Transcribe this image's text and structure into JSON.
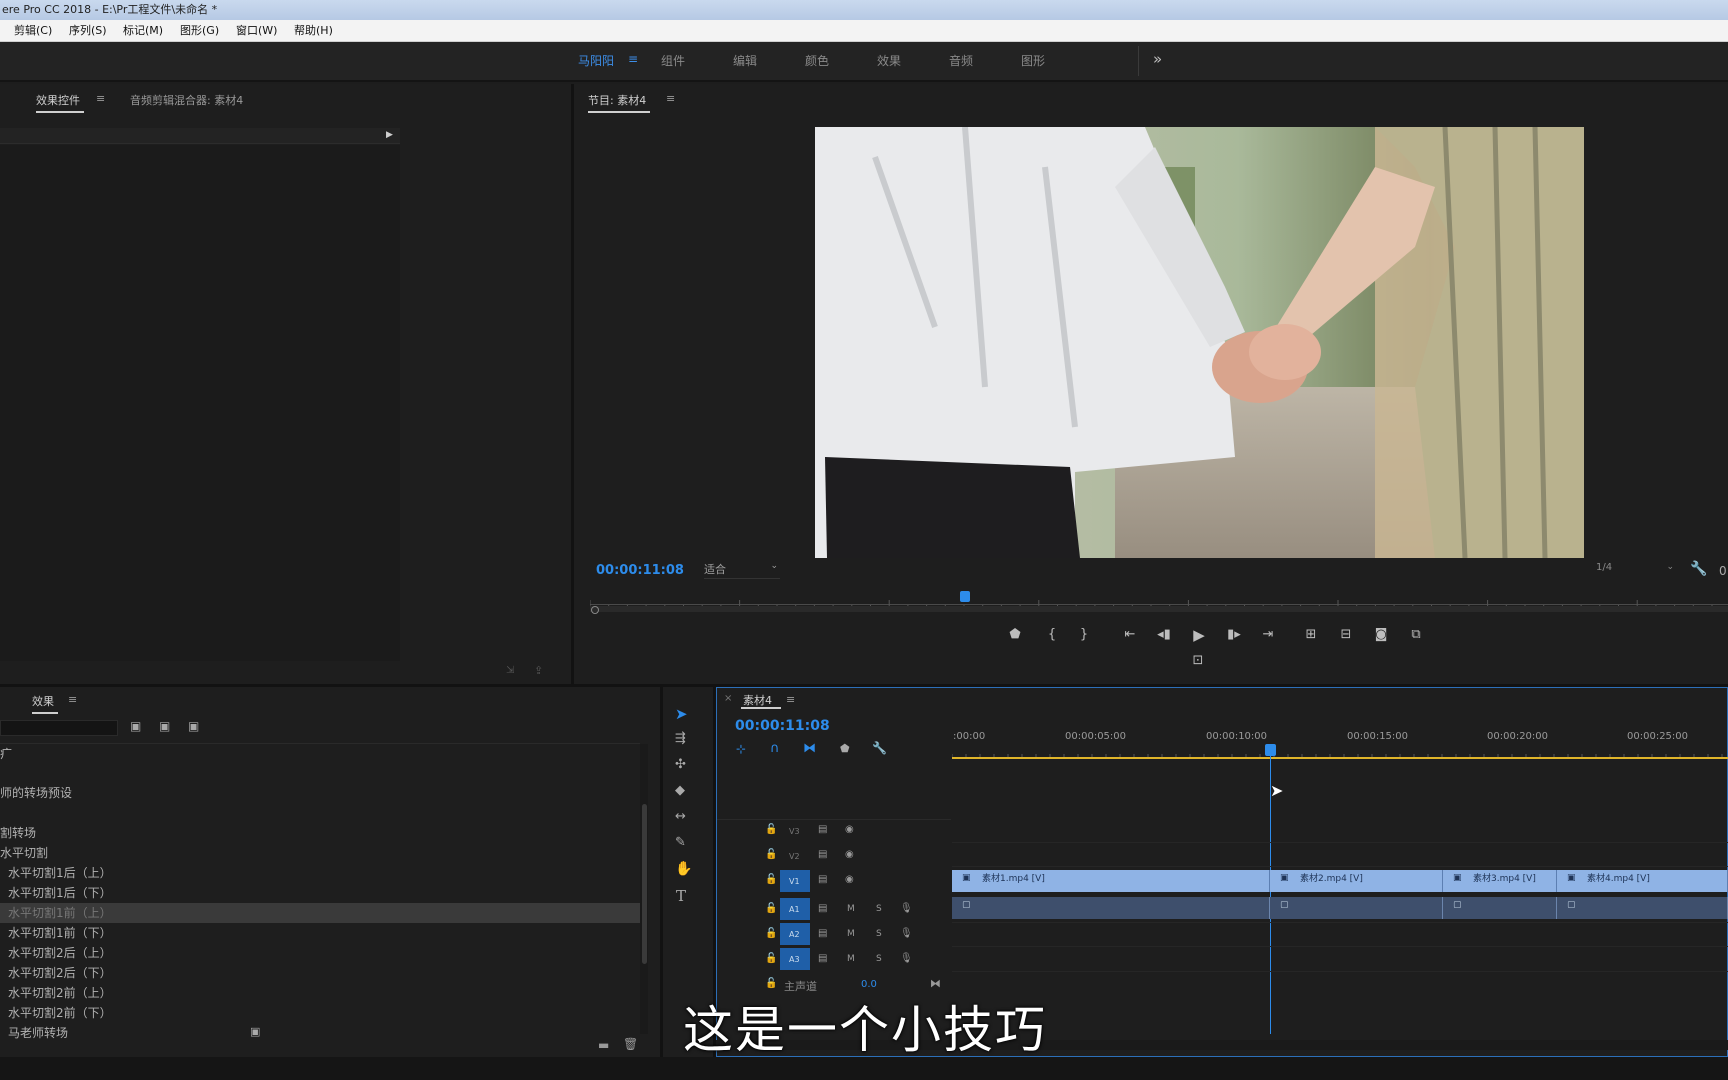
{
  "window": {
    "title": "ere Pro CC 2018 - E:\\Pr工程文件\\未命名 *"
  },
  "menu": [
    "剪辑(C)",
    "序列(S)",
    "标记(M)",
    "图形(G)",
    "窗口(W)",
    "帮助(H)"
  ],
  "workspaces": [
    "马阳阳",
    "组件",
    "编辑",
    "颜色",
    "效果",
    "音频",
    "图形"
  ],
  "workspace_more": "»",
  "left_panel": {
    "tabs": [
      "效果控件",
      "音频剪辑混合器: 素材4"
    ]
  },
  "program_monitor": {
    "title": "节目: 素材4",
    "timecode": "00:00:11:08",
    "fit": "适合",
    "resolution": "1/4",
    "right_value": "0"
  },
  "effects_panel": {
    "title": "效果",
    "items": [
      {
        "label": "疒"
      },
      {
        "label": ""
      },
      {
        "label": "师的转场预设"
      },
      {
        "label": ""
      },
      {
        "label": "割转场"
      },
      {
        "label": "水平切割"
      },
      {
        "label": "水平切割1后（上）"
      },
      {
        "label": "水平切割1后（下）"
      },
      {
        "label": "水平切割1前（上）",
        "selected": true
      },
      {
        "label": "水平切割1前（下）"
      },
      {
        "label": "水平切割2后（上）"
      },
      {
        "label": "水平切割2后（下）"
      },
      {
        "label": "水平切割2前（上）"
      },
      {
        "label": "水平切割2前（下）"
      },
      {
        "label": "马老师转场"
      }
    ]
  },
  "timeline": {
    "sequence_name": "素材4",
    "timecode": "00:00:11:08",
    "ruler": [
      ":00:00",
      "00:00:05:00",
      "00:00:10:00",
      "00:00:15:00",
      "00:00:20:00",
      "00:00:25:00"
    ],
    "video_tracks": [
      "V3",
      "V2",
      "V1"
    ],
    "audio_tracks": [
      "A1",
      "A2",
      "A3"
    ],
    "master": {
      "label": "主声道",
      "value": "0.0"
    },
    "video_clips": [
      "素材1.mp4 [V]",
      "素材2.mp4 [V]",
      "素材3.mp4 [V]",
      "素材4.mp4 [V]"
    ],
    "mute_label": "M",
    "solo_label": "S"
  },
  "colors": {
    "accent": "#2d8ceb",
    "clip_video": "#8fb3e5",
    "clip_audio": "#3e4f6c",
    "work_area": "#e0b52a"
  },
  "subtitle": "这是一个小技巧"
}
